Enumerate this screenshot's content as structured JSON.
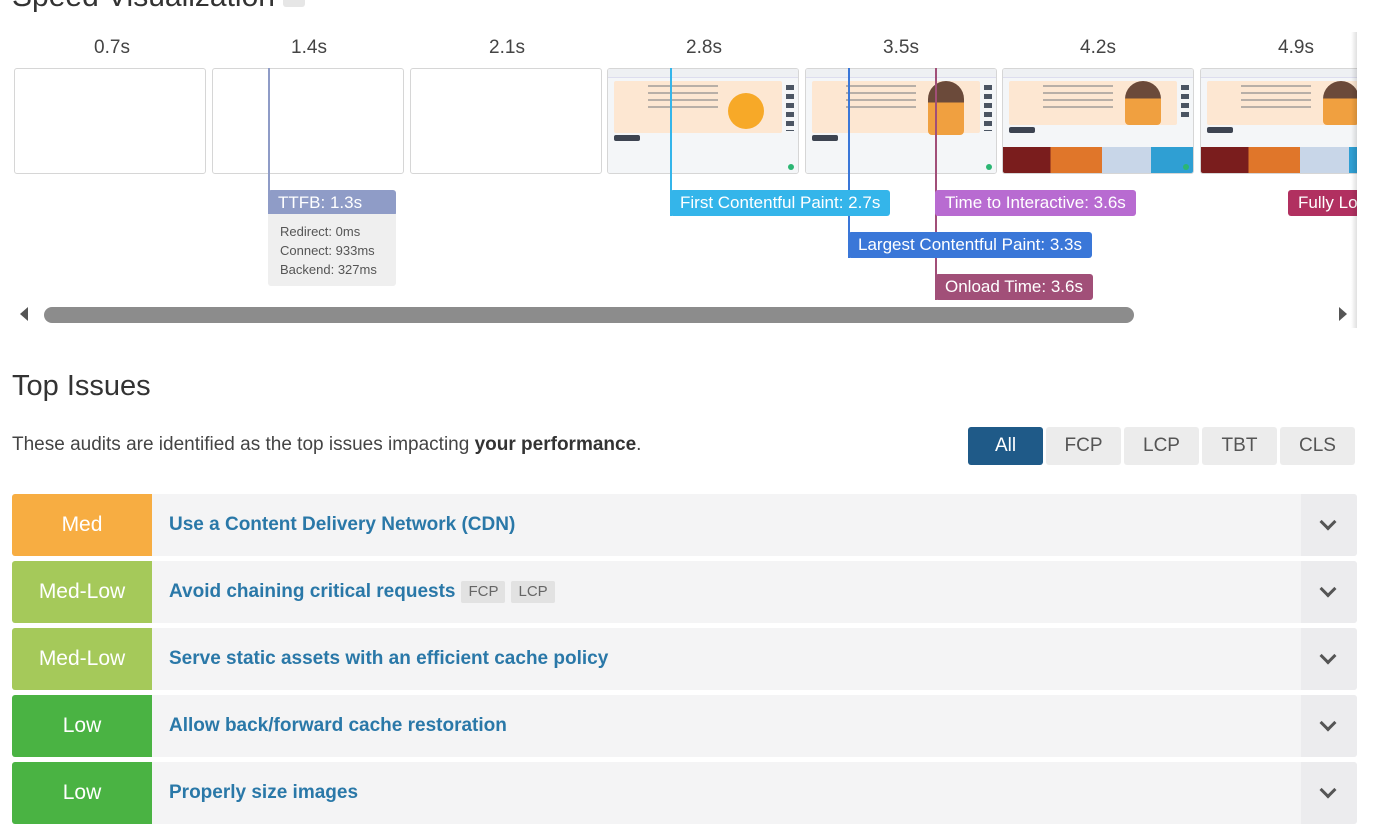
{
  "speed": {
    "title": "Speed Visualization",
    "ticks": [
      "0.7s",
      "1.4s",
      "2.1s",
      "2.8s",
      "3.5s",
      "4.2s",
      "4.9s"
    ],
    "markers": {
      "ttfb": "TTFB: 1.3s",
      "fcp": "First Contentful Paint: 2.7s",
      "tti": "Time to Interactive: 3.6s",
      "fully": "Fully Lo",
      "lcp": "Largest Contentful Paint: 3.3s",
      "onload": "Onload Time: 3.6s"
    },
    "ttfb_details": {
      "redirect": "Redirect: 0ms",
      "connect": "Connect: 933ms",
      "backend": "Backend: 327ms"
    },
    "colors": {
      "ttfb": "#8f9cc7",
      "fcp": "#34b5ea",
      "tti": "#b86bd1",
      "lcp": "#3a77d8",
      "onload": "#a14f78",
      "fully": "#b13060"
    }
  },
  "issues": {
    "title": "Top Issues",
    "description_pre": "These audits are identified as the top issues impacting ",
    "description_bold": "your performance",
    "description_post": ".",
    "filters": [
      "All",
      "FCP",
      "LCP",
      "TBT",
      "CLS"
    ],
    "items": [
      {
        "severity": "Med",
        "color": "#f7ad42",
        "title": "Use a Content Delivery Network (CDN)",
        "chips": []
      },
      {
        "severity": "Med-Low",
        "color": "#a5c95a",
        "title": "Avoid chaining critical requests",
        "chips": [
          "FCP",
          "LCP"
        ]
      },
      {
        "severity": "Med-Low",
        "color": "#a5c95a",
        "title": "Serve static assets with an efficient cache policy",
        "chips": []
      },
      {
        "severity": "Low",
        "color": "#4ab343",
        "title": "Allow back/forward cache restoration",
        "chips": []
      },
      {
        "severity": "Low",
        "color": "#4ab343",
        "title": "Properly size images",
        "chips": []
      }
    ]
  }
}
